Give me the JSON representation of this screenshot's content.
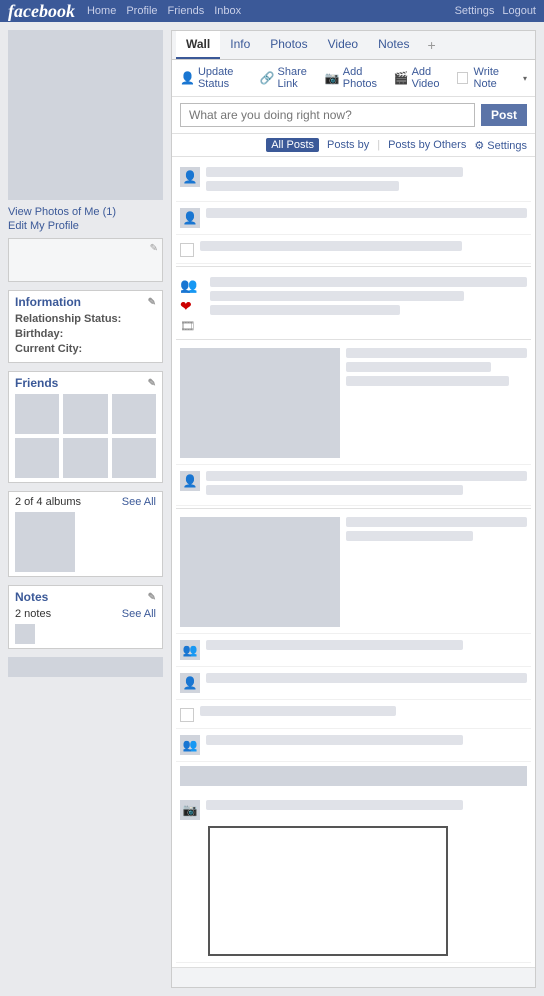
{
  "nav": {
    "logo": "facebook",
    "links": [
      "Home",
      "Profile",
      "Friends",
      "Inbox"
    ],
    "right_links": [
      "Settings",
      "Logout"
    ]
  },
  "tabs": [
    "Wall",
    "Info",
    "Photos",
    "Video",
    "Notes"
  ],
  "tab_plus": "+",
  "active_tab": "Wall",
  "actions": {
    "update_status": "Update Status",
    "share_link": "Share Link",
    "add_photos": "Add Photos",
    "add_video": "Add Video",
    "write_note": "Write Note",
    "dropdown": "▾"
  },
  "status_input": {
    "placeholder": "What are you doing right now?",
    "post_button": "Post"
  },
  "filter": {
    "all_posts": "All Posts",
    "posts_by": "Posts by",
    "posts_by_others": "Posts by Others",
    "settings": "⚙ Settings"
  },
  "sidebar": {
    "view_photos": "View Photos of Me (1)",
    "edit_profile": "Edit My Profile",
    "information_title": "Information",
    "relationship_label": "Relationship Status:",
    "birthday_label": "Birthday:",
    "city_label": "Current City:",
    "friends_title": "Friends",
    "albums_label": "2 of 4 albums",
    "see_all": "See All",
    "notes_title": "Notes",
    "notes_count": "2 notes"
  },
  "icons": {
    "people": "👤",
    "group": "👥",
    "heart": "❤",
    "film": "🎞",
    "photo": "📷",
    "pencil": "✎",
    "gear": "⚙"
  }
}
